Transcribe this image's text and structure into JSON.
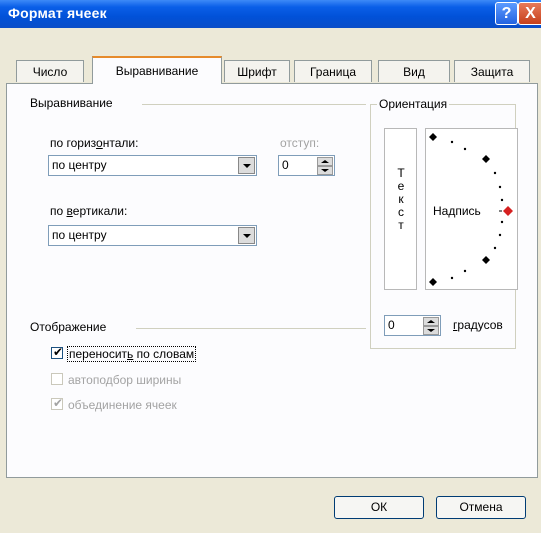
{
  "window": {
    "title": "Формат ячеек",
    "help_label": "?",
    "close_label": "X"
  },
  "tabs": [
    {
      "label": "Число",
      "active": false
    },
    {
      "label": "Выравнивание",
      "active": true
    },
    {
      "label": "Шрифт",
      "active": false
    },
    {
      "label": "Граница",
      "active": false
    },
    {
      "label": "Вид",
      "active": false
    },
    {
      "label": "Защита",
      "active": false
    }
  ],
  "alignment": {
    "group_title": "Выравнивание",
    "horizontal_label_pre": "по гориз",
    "horizontal_label_accel": "о",
    "horizontal_label_post": "нтали:",
    "horizontal_value": "по центру",
    "indent_label": "отступ:",
    "indent_value": "0",
    "vertical_label_pre": "по ",
    "vertical_label_accel": "в",
    "vertical_label_post": "ертикали:",
    "vertical_value": "по центру"
  },
  "display": {
    "group_title": "Отображение",
    "wrap_label_pre": "переносит",
    "wrap_label_accel": "ь",
    "wrap_label_post": " по словам",
    "wrap_checked": true,
    "autofit_label": "автоподбор ширины",
    "autofit_checked": false,
    "merge_label": "объединение ячеек",
    "merge_checked": true
  },
  "orientation": {
    "group_title": "Ориентация",
    "vertical_text": [
      "Т",
      "е",
      "к",
      "с",
      "т"
    ],
    "dial_label": "Надпись",
    "degrees_value": "0",
    "degrees_label_accel": "г",
    "degrees_label_post": "радусов"
  },
  "buttons": {
    "ok": "ОК",
    "cancel": "Отмена"
  },
  "colors": {
    "title_bar": "#0151d8",
    "dialog_bg": "#ece9d8",
    "active_tab_accent": "#e68b2c",
    "dial_marker_active": "#d62020"
  }
}
